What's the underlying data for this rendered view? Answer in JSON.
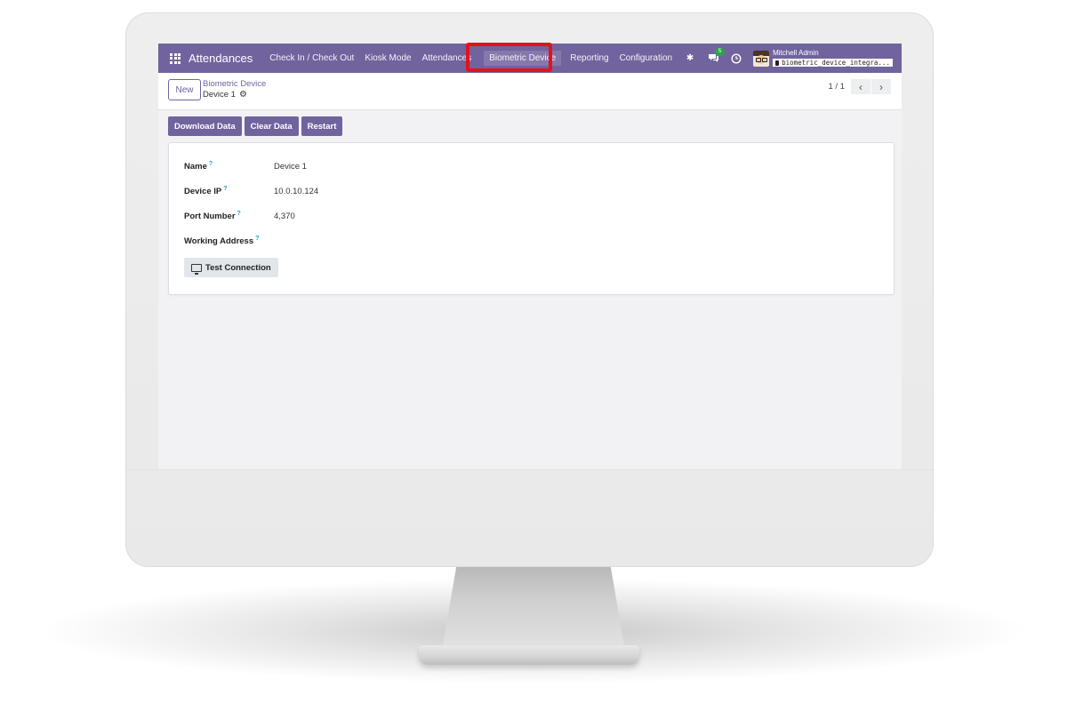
{
  "navbar": {
    "app_name": "Attendances",
    "menu": [
      {
        "label": "Check In / Check Out"
      },
      {
        "label": "Kiosk Mode"
      },
      {
        "label": "Attendances"
      },
      {
        "label": "Biometric Device"
      },
      {
        "label": "Reporting"
      },
      {
        "label": "Configuration"
      }
    ],
    "active_menu": "Biometric Device",
    "messages_badge": "5",
    "user_name": "Mitchell Admin",
    "database": "biometric_device_integra..."
  },
  "control_panel": {
    "new_label": "New",
    "breadcrumb_parent": "Biometric Device",
    "breadcrumb_current": "Device 1",
    "pager": "1 / 1"
  },
  "actions": {
    "download": "Download Data",
    "clear": "Clear Data",
    "restart": "Restart"
  },
  "form": {
    "fields": [
      {
        "label": "Name",
        "value": "Device 1"
      },
      {
        "label": "Device IP",
        "value": "10.0.10.124"
      },
      {
        "label": "Port Number",
        "value": "4,370"
      },
      {
        "label": "Working Address",
        "value": ""
      }
    ],
    "help_mark": "?",
    "test_connection": "Test Connection"
  },
  "colors": {
    "brand": "#71639e",
    "highlight": "#e8101a",
    "help": "#1a9bd7",
    "badge": "#28a745"
  }
}
